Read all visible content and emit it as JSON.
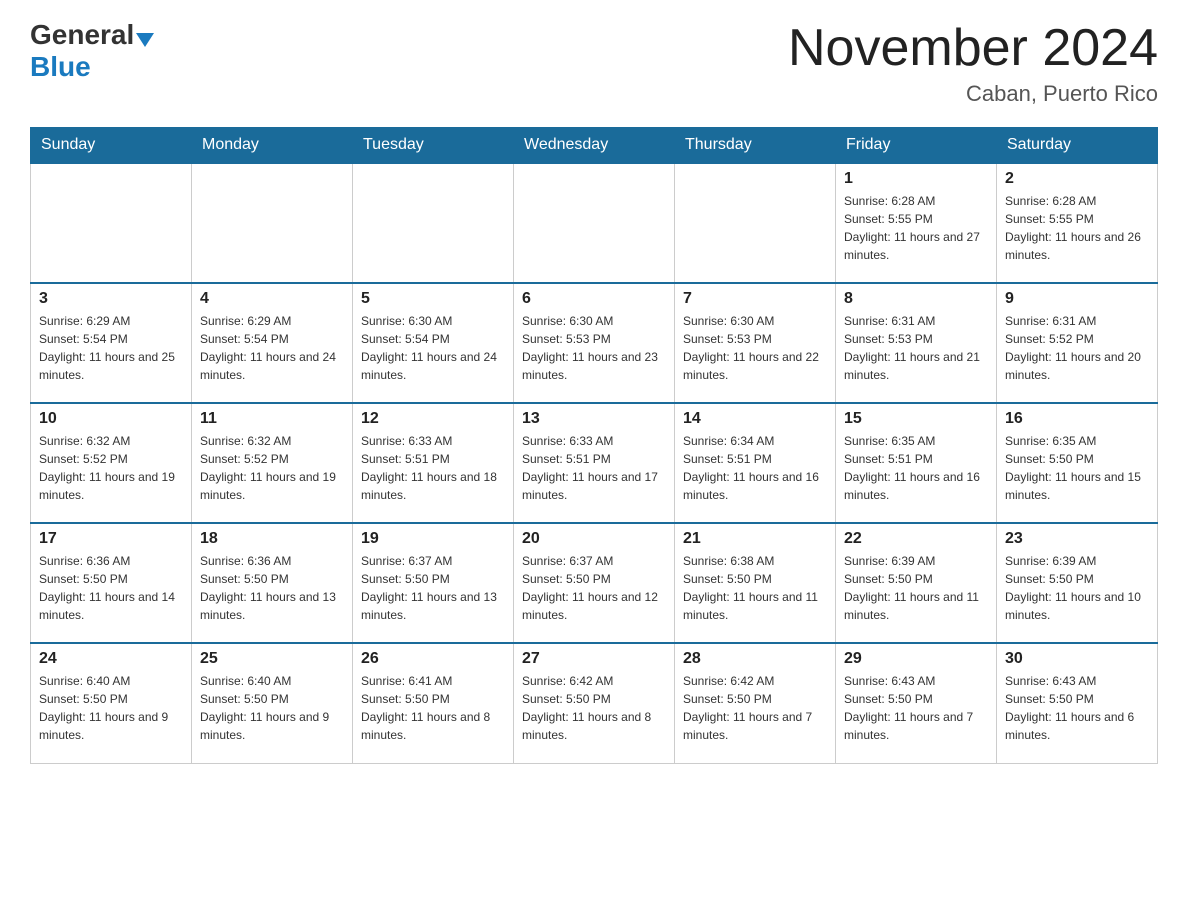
{
  "header": {
    "logo_general": "General",
    "logo_blue": "Blue",
    "title": "November 2024",
    "subtitle": "Caban, Puerto Rico"
  },
  "weekdays": [
    "Sunday",
    "Monday",
    "Tuesday",
    "Wednesday",
    "Thursday",
    "Friday",
    "Saturday"
  ],
  "weeks": [
    [
      {
        "day": "",
        "sunrise": "",
        "sunset": "",
        "daylight": ""
      },
      {
        "day": "",
        "sunrise": "",
        "sunset": "",
        "daylight": ""
      },
      {
        "day": "",
        "sunrise": "",
        "sunset": "",
        "daylight": ""
      },
      {
        "day": "",
        "sunrise": "",
        "sunset": "",
        "daylight": ""
      },
      {
        "day": "",
        "sunrise": "",
        "sunset": "",
        "daylight": ""
      },
      {
        "day": "1",
        "sunrise": "Sunrise: 6:28 AM",
        "sunset": "Sunset: 5:55 PM",
        "daylight": "Daylight: 11 hours and 27 minutes."
      },
      {
        "day": "2",
        "sunrise": "Sunrise: 6:28 AM",
        "sunset": "Sunset: 5:55 PM",
        "daylight": "Daylight: 11 hours and 26 minutes."
      }
    ],
    [
      {
        "day": "3",
        "sunrise": "Sunrise: 6:29 AM",
        "sunset": "Sunset: 5:54 PM",
        "daylight": "Daylight: 11 hours and 25 minutes."
      },
      {
        "day": "4",
        "sunrise": "Sunrise: 6:29 AM",
        "sunset": "Sunset: 5:54 PM",
        "daylight": "Daylight: 11 hours and 24 minutes."
      },
      {
        "day": "5",
        "sunrise": "Sunrise: 6:30 AM",
        "sunset": "Sunset: 5:54 PM",
        "daylight": "Daylight: 11 hours and 24 minutes."
      },
      {
        "day": "6",
        "sunrise": "Sunrise: 6:30 AM",
        "sunset": "Sunset: 5:53 PM",
        "daylight": "Daylight: 11 hours and 23 minutes."
      },
      {
        "day": "7",
        "sunrise": "Sunrise: 6:30 AM",
        "sunset": "Sunset: 5:53 PM",
        "daylight": "Daylight: 11 hours and 22 minutes."
      },
      {
        "day": "8",
        "sunrise": "Sunrise: 6:31 AM",
        "sunset": "Sunset: 5:53 PM",
        "daylight": "Daylight: 11 hours and 21 minutes."
      },
      {
        "day": "9",
        "sunrise": "Sunrise: 6:31 AM",
        "sunset": "Sunset: 5:52 PM",
        "daylight": "Daylight: 11 hours and 20 minutes."
      }
    ],
    [
      {
        "day": "10",
        "sunrise": "Sunrise: 6:32 AM",
        "sunset": "Sunset: 5:52 PM",
        "daylight": "Daylight: 11 hours and 19 minutes."
      },
      {
        "day": "11",
        "sunrise": "Sunrise: 6:32 AM",
        "sunset": "Sunset: 5:52 PM",
        "daylight": "Daylight: 11 hours and 19 minutes."
      },
      {
        "day": "12",
        "sunrise": "Sunrise: 6:33 AM",
        "sunset": "Sunset: 5:51 PM",
        "daylight": "Daylight: 11 hours and 18 minutes."
      },
      {
        "day": "13",
        "sunrise": "Sunrise: 6:33 AM",
        "sunset": "Sunset: 5:51 PM",
        "daylight": "Daylight: 11 hours and 17 minutes."
      },
      {
        "day": "14",
        "sunrise": "Sunrise: 6:34 AM",
        "sunset": "Sunset: 5:51 PM",
        "daylight": "Daylight: 11 hours and 16 minutes."
      },
      {
        "day": "15",
        "sunrise": "Sunrise: 6:35 AM",
        "sunset": "Sunset: 5:51 PM",
        "daylight": "Daylight: 11 hours and 16 minutes."
      },
      {
        "day": "16",
        "sunrise": "Sunrise: 6:35 AM",
        "sunset": "Sunset: 5:50 PM",
        "daylight": "Daylight: 11 hours and 15 minutes."
      }
    ],
    [
      {
        "day": "17",
        "sunrise": "Sunrise: 6:36 AM",
        "sunset": "Sunset: 5:50 PM",
        "daylight": "Daylight: 11 hours and 14 minutes."
      },
      {
        "day": "18",
        "sunrise": "Sunrise: 6:36 AM",
        "sunset": "Sunset: 5:50 PM",
        "daylight": "Daylight: 11 hours and 13 minutes."
      },
      {
        "day": "19",
        "sunrise": "Sunrise: 6:37 AM",
        "sunset": "Sunset: 5:50 PM",
        "daylight": "Daylight: 11 hours and 13 minutes."
      },
      {
        "day": "20",
        "sunrise": "Sunrise: 6:37 AM",
        "sunset": "Sunset: 5:50 PM",
        "daylight": "Daylight: 11 hours and 12 minutes."
      },
      {
        "day": "21",
        "sunrise": "Sunrise: 6:38 AM",
        "sunset": "Sunset: 5:50 PM",
        "daylight": "Daylight: 11 hours and 11 minutes."
      },
      {
        "day": "22",
        "sunrise": "Sunrise: 6:39 AM",
        "sunset": "Sunset: 5:50 PM",
        "daylight": "Daylight: 11 hours and 11 minutes."
      },
      {
        "day": "23",
        "sunrise": "Sunrise: 6:39 AM",
        "sunset": "Sunset: 5:50 PM",
        "daylight": "Daylight: 11 hours and 10 minutes."
      }
    ],
    [
      {
        "day": "24",
        "sunrise": "Sunrise: 6:40 AM",
        "sunset": "Sunset: 5:50 PM",
        "daylight": "Daylight: 11 hours and 9 minutes."
      },
      {
        "day": "25",
        "sunrise": "Sunrise: 6:40 AM",
        "sunset": "Sunset: 5:50 PM",
        "daylight": "Daylight: 11 hours and 9 minutes."
      },
      {
        "day": "26",
        "sunrise": "Sunrise: 6:41 AM",
        "sunset": "Sunset: 5:50 PM",
        "daylight": "Daylight: 11 hours and 8 minutes."
      },
      {
        "day": "27",
        "sunrise": "Sunrise: 6:42 AM",
        "sunset": "Sunset: 5:50 PM",
        "daylight": "Daylight: 11 hours and 8 minutes."
      },
      {
        "day": "28",
        "sunrise": "Sunrise: 6:42 AM",
        "sunset": "Sunset: 5:50 PM",
        "daylight": "Daylight: 11 hours and 7 minutes."
      },
      {
        "day": "29",
        "sunrise": "Sunrise: 6:43 AM",
        "sunset": "Sunset: 5:50 PM",
        "daylight": "Daylight: 11 hours and 7 minutes."
      },
      {
        "day": "30",
        "sunrise": "Sunrise: 6:43 AM",
        "sunset": "Sunset: 5:50 PM",
        "daylight": "Daylight: 11 hours and 6 minutes."
      }
    ]
  ]
}
